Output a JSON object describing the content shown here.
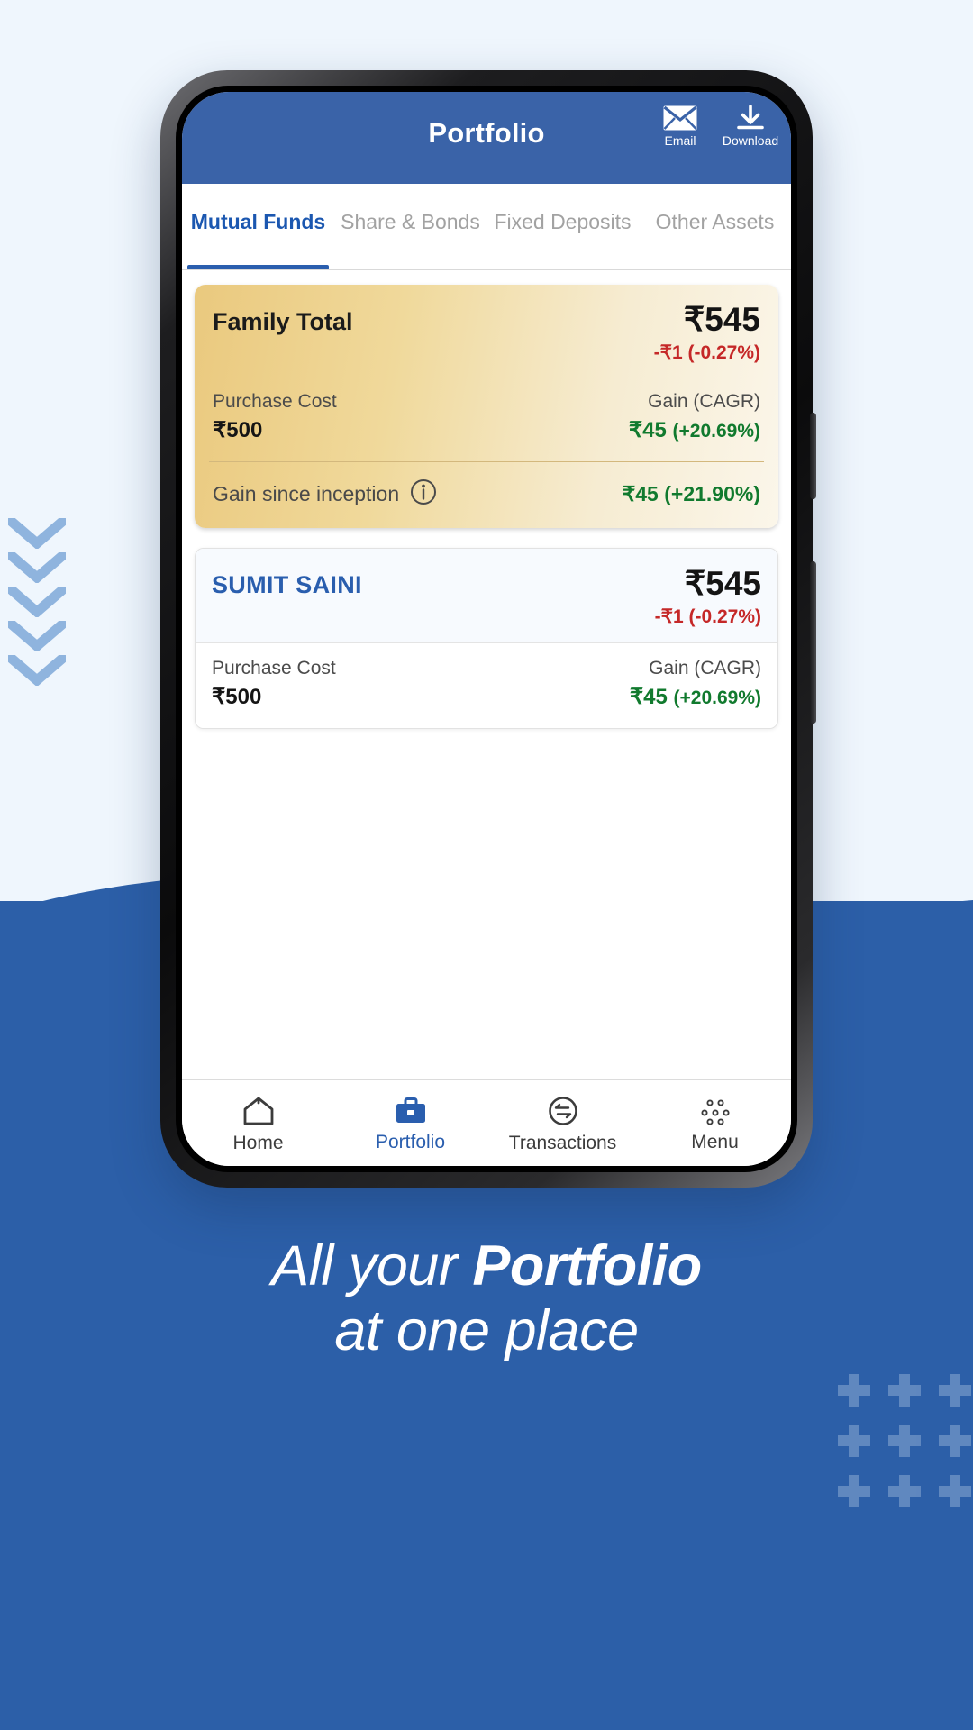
{
  "promo": {
    "tagline_line1_pre": "All your ",
    "tagline_line1_strong": "Portfolio",
    "tagline_line2": "at one place"
  },
  "colors": {
    "brand_blue": "#3a63a8",
    "page_blue": "#2c5fa8",
    "page_light": "#eff6fd",
    "accent_link": "#2a5eae",
    "gain_green": "#117a2e",
    "loss_red": "#c52828",
    "card_gold_from": "#eac97e",
    "card_gold_to": "#fbf6ea"
  },
  "header": {
    "title": "Portfolio",
    "actions": [
      {
        "label": "Email",
        "icon": "envelope-icon"
      },
      {
        "label": "Download",
        "icon": "download-icon"
      }
    ]
  },
  "tabs": [
    {
      "label": "Mutual Funds",
      "active": true
    },
    {
      "label": "Share & Bonds",
      "active": false
    },
    {
      "label": "Fixed Deposits",
      "active": false
    },
    {
      "label": "Other Assets",
      "active": false
    }
  ],
  "family_card": {
    "title": "Family Total",
    "current_value": "₹545",
    "day_change": "-₹1 (-0.27%)",
    "purchase_cost_label": "Purchase Cost",
    "purchase_cost_value": "₹500",
    "gain_label": "Gain (CAGR)",
    "gain_value": "₹45",
    "gain_pct": "(+20.69%)",
    "inception_label": "Gain since inception",
    "inception_info_icon": "info-icon",
    "inception_value": "₹45 (+21.90%)"
  },
  "member_card": {
    "name": "SUMIT SAINI",
    "current_value": "₹545",
    "day_change": "-₹1 (-0.27%)",
    "purchase_cost_label": "Purchase Cost",
    "purchase_cost_value": "₹500",
    "gain_label": "Gain (CAGR)",
    "gain_value": "₹45",
    "gain_pct": "(+20.69%)"
  },
  "bottom_nav": [
    {
      "label": "Home",
      "icon": "home-icon",
      "active": false
    },
    {
      "label": "Portfolio",
      "icon": "briefcase-icon",
      "active": true
    },
    {
      "label": "Transactions",
      "icon": "exchange-circle-icon",
      "active": false
    },
    {
      "label": "Menu",
      "icon": "dots-grid-icon",
      "active": false
    }
  ]
}
